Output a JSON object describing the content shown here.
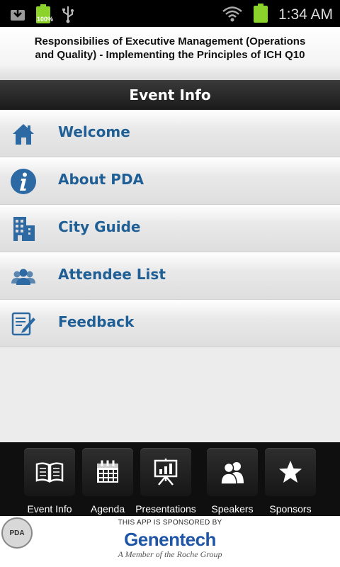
{
  "status_bar": {
    "battery_percent": "100%",
    "time": "1:34 AM",
    "icons": [
      "download-icon",
      "battery-icon",
      "usb-icon",
      "wifi-icon",
      "battery-full-icon"
    ]
  },
  "banner": {
    "title": "Responsibilies of Executive Management (Operations and Quality) - Implementing the Principles of ICH Q10"
  },
  "section": {
    "title": "Event Info"
  },
  "menu": {
    "items": [
      {
        "label": "Welcome",
        "icon": "home-icon"
      },
      {
        "label": "About PDA",
        "icon": "info-icon"
      },
      {
        "label": "City Guide",
        "icon": "building-icon"
      },
      {
        "label": "Attendee List",
        "icon": "people-icon"
      },
      {
        "label": "Feedback",
        "icon": "feedback-pencil-icon"
      }
    ]
  },
  "tabbar": {
    "tabs": [
      {
        "label": "Event Info",
        "icon": "book-icon"
      },
      {
        "label": "Agenda",
        "icon": "calendar-icon"
      },
      {
        "label": "Presentations",
        "icon": "presentation-icon"
      },
      {
        "label": "Speakers",
        "icon": "speakers-icon"
      },
      {
        "label": "Sponsors",
        "icon": "star-icon"
      }
    ]
  },
  "sponsor": {
    "logo_text": "PDA",
    "line1": "THIS APP IS SPONSORED BY",
    "brand": "Genentech",
    "tagline": "A Member of the Roche Group"
  },
  "colors": {
    "link_blue": "#1f5f95",
    "icon_blue": "#2d6aa3",
    "battery_green": "#8bd22a",
    "brand_blue": "#1e55a6"
  }
}
